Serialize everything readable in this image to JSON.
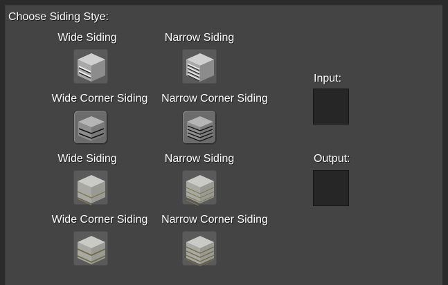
{
  "panel": {
    "title": "Choose Siding Stye:"
  },
  "grid": {
    "row1": {
      "left_label": "Wide Siding",
      "right_label": "Narrow Siding"
    },
    "row2": {
      "left_label": "Wide Corner Siding",
      "right_label": "Narrow Corner Siding"
    },
    "row3": {
      "left_label": "Wide Siding",
      "right_label": "Narrow Siding"
    },
    "row4": {
      "left_label": "Wide Corner Siding",
      "right_label": "Narrow Corner Siding"
    }
  },
  "slots": {
    "input_label": "Input:",
    "output_label": "Output:"
  },
  "icons": {
    "row1_left": "wide-siding-stone-icon",
    "row1_right": "narrow-siding-stone-icon",
    "row2_left": "wide-corner-siding-stone-icon",
    "row2_right": "narrow-corner-siding-stone-icon",
    "row3_left": "wide-siding-sandstone-icon",
    "row3_right": "narrow-siding-sandstone-icon",
    "row4_left": "wide-corner-siding-sandstone-icon",
    "row4_right": "narrow-corner-siding-sandstone-icon"
  },
  "colors": {
    "background": "#2b2b2b",
    "panel": "#444444",
    "text": "#ffffff",
    "slot": "#262626"
  }
}
